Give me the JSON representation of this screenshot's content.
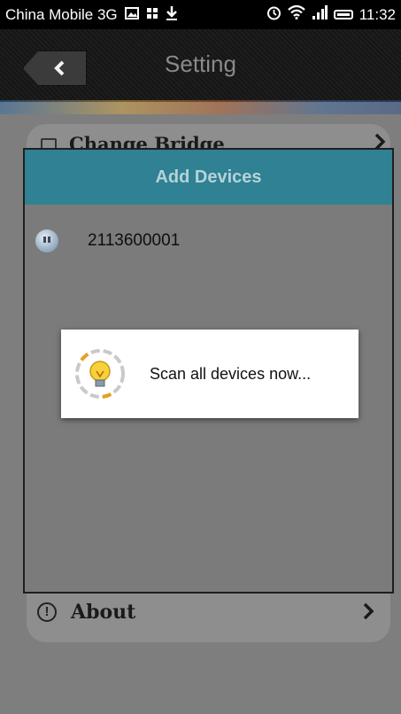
{
  "status_bar": {
    "carrier": "China Mobile 3G",
    "icons": [
      "image-icon",
      "grid-icon",
      "download-icon",
      "alarm-icon",
      "wifi-icon",
      "signal-icon",
      "battery-icon"
    ],
    "time": "11:32"
  },
  "title_bar": {
    "title": "Setting",
    "back_icon": "chevron-left-icon"
  },
  "settings_list": {
    "partial_item_label": "Change Bridge",
    "about_label": "About"
  },
  "dialog": {
    "title": "Add Devices",
    "devices": [
      {
        "name": "2113600001",
        "icon": "plug-icon"
      }
    ]
  },
  "progress": {
    "message": "Scan all devices now...",
    "icon": "lightbulb-icon"
  },
  "colors": {
    "dialog_header": "#2f8193",
    "dialog_title_text": "#b6d2d9",
    "overlay": "#7b7b7b"
  }
}
